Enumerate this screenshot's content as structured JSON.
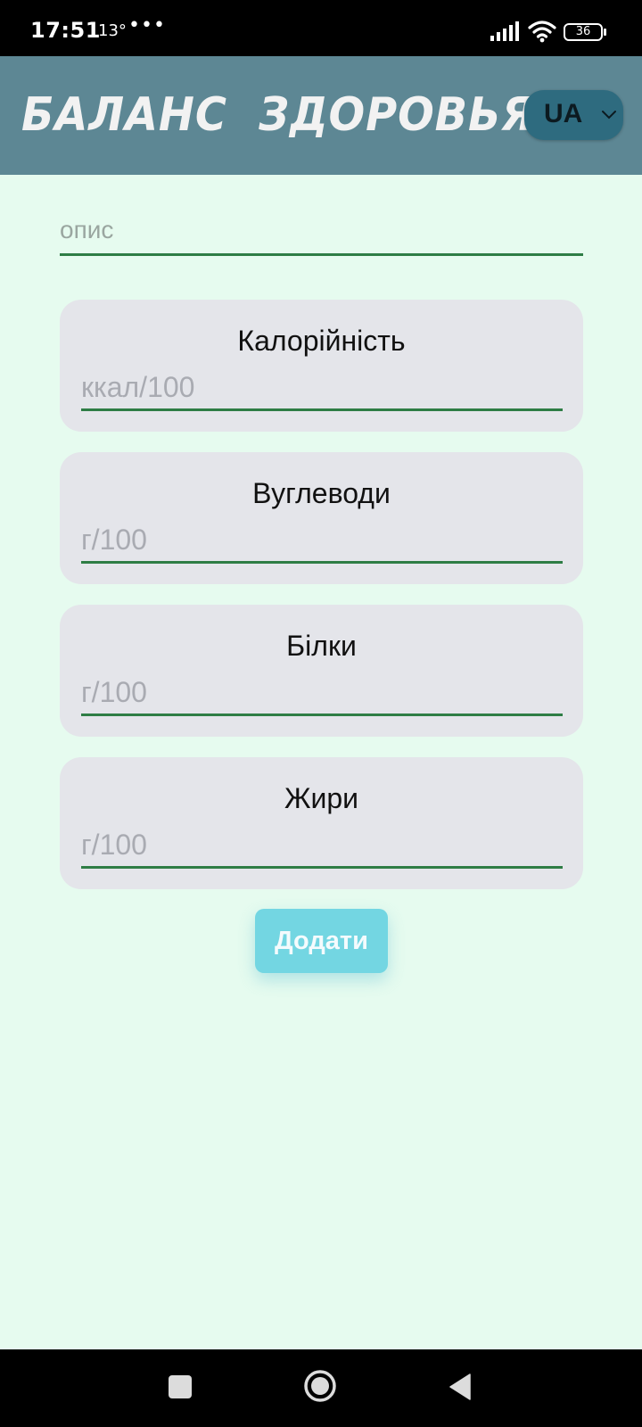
{
  "status_bar": {
    "time": "17:51",
    "temperature": "13°",
    "more": "•••",
    "battery": "36"
  },
  "header": {
    "title": "БАЛАНС  ЗДОРОВЬЯ",
    "language": "UA"
  },
  "form": {
    "description_placeholder": "опис",
    "cards": [
      {
        "label": "Калорійність",
        "placeholder": "ккал/100"
      },
      {
        "label": "Вуглеводи",
        "placeholder": "г/100"
      },
      {
        "label": "Білки",
        "placeholder": "г/100"
      },
      {
        "label": "Жири",
        "placeholder": "г/100"
      }
    ],
    "add_label": "Додати"
  },
  "colors": {
    "header_bg": "#5d8794",
    "page_bg": "#e6fbef",
    "accent_underline": "#2e7d45",
    "button_bg": "#73d6e2",
    "card_bg": "#e4e5ea"
  },
  "icons": {
    "status": [
      "signal-icon",
      "wifi-icon",
      "battery-icon"
    ],
    "navigation": [
      "recent-apps-icon",
      "home-icon",
      "back-icon"
    ],
    "select": "chevron-down-icon"
  }
}
